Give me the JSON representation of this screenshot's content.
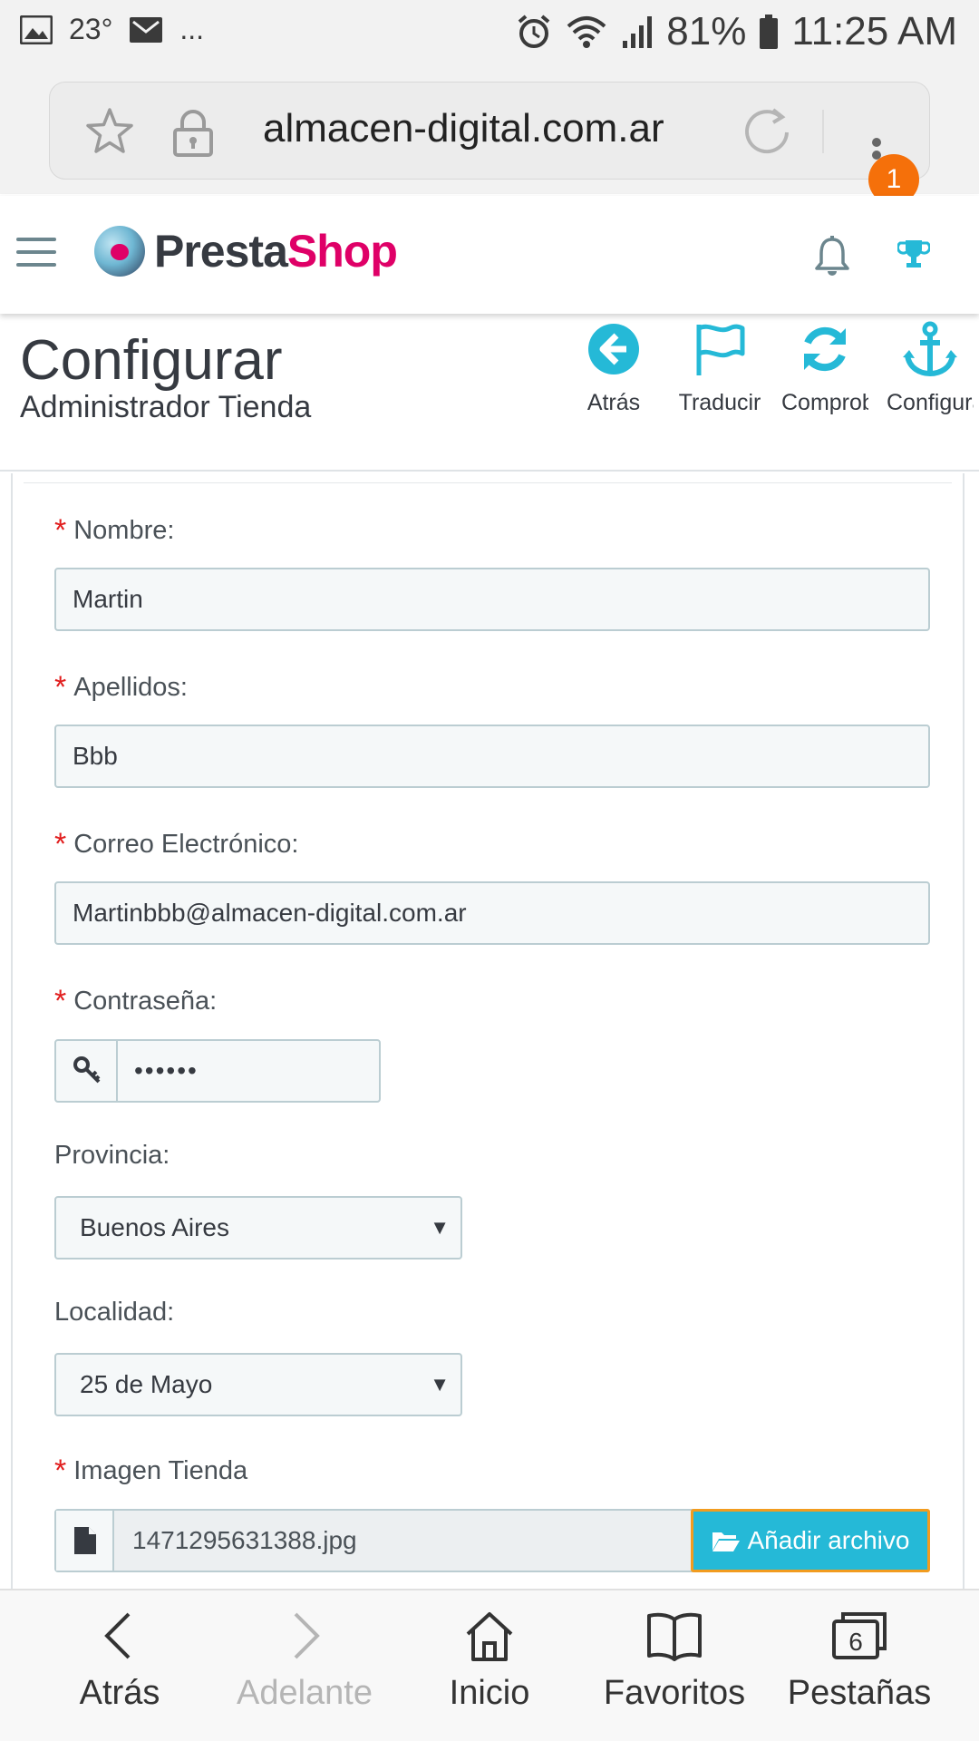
{
  "statusbar": {
    "temperature": "23°",
    "dots": "...",
    "battery": "81%",
    "time": "11:25 AM"
  },
  "browser": {
    "url": "almacen-digital.com.ar",
    "notification_count": "1"
  },
  "header": {
    "brand_part1": "Presta",
    "brand_part2": "Shop"
  },
  "toolbar": {
    "title": "Configurar",
    "subtitle": "Administrador Tienda",
    "buttons": [
      {
        "label": "Atrás",
        "icon": "arrow-left-circle-icon"
      },
      {
        "label": "Traducir",
        "icon": "flag-icon"
      },
      {
        "label": "Comprobar",
        "icon": "refresh-icon"
      },
      {
        "label": "Configurar",
        "icon": "anchor-icon"
      }
    ]
  },
  "form": {
    "nombre": {
      "label": "Nombre:",
      "value": "Martin"
    },
    "apellidos": {
      "label": "Apellidos:",
      "value": "Bbb"
    },
    "correo": {
      "label": "Correo Electrónico:",
      "value": "Martinbbb@almacen-digital.com.ar"
    },
    "password": {
      "label": "Contraseña:",
      "value": "••••••"
    },
    "provincia": {
      "label": "Provincia:",
      "selected": "Buenos Aires"
    },
    "localidad": {
      "label": "Localidad:",
      "selected": "25 de Mayo"
    },
    "imagen": {
      "label": "Imagen Tienda",
      "filename": "1471295631388.jpg",
      "button": "Añadir archivo"
    }
  },
  "bottomnav": {
    "items": [
      {
        "label": "Atrás"
      },
      {
        "label": "Adelante"
      },
      {
        "label": "Inicio"
      },
      {
        "label": "Favoritos"
      },
      {
        "label": "Pestañas"
      }
    ],
    "tab_count": "6"
  },
  "colors": {
    "accent": "#25b9d7",
    "brand_pink": "#df0067",
    "required": "#e11d1d",
    "badge": "#f5700a"
  }
}
